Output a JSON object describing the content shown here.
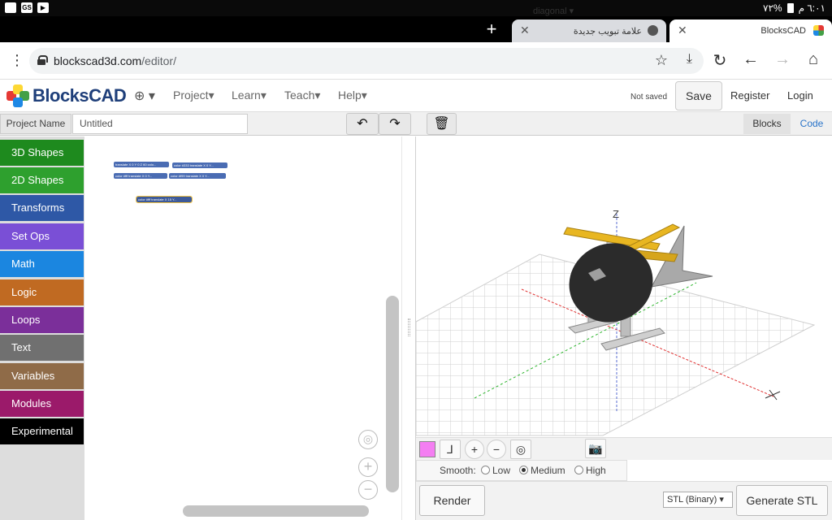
{
  "status_bar": {
    "left_icons": [
      "gallery-icon",
      "gs-icon",
      "youtube-icon"
    ],
    "gs_label": "GS",
    "battery": "٧٢%",
    "time": "٦:٠١ م"
  },
  "tabs": [
    {
      "title": "علامة تبويب جديدة",
      "active": false
    },
    {
      "title": "BlocksCAD",
      "active": true
    }
  ],
  "address": {
    "host": "blockscad3d.com",
    "path": "/editor/"
  },
  "header": {
    "logo_text": "BlocksCAD",
    "menus": [
      "Project",
      "Learn",
      "Teach",
      "Help"
    ],
    "save_status": "Not saved",
    "save_label": "Save",
    "register_label": "Register",
    "login_label": "Login"
  },
  "project": {
    "name_label": "Project Name",
    "name_value": "Untitled",
    "blocks_tab": "Blocks",
    "code_tab": "Code"
  },
  "categories": [
    {
      "label": "3D Shapes",
      "color": "#1e8a1e"
    },
    {
      "label": "2D Shapes",
      "color": "#2ea02e"
    },
    {
      "label": "Transforms",
      "color": "#2e58a6"
    },
    {
      "label": "Set Ops",
      "color": "#7a4fd6"
    },
    {
      "label": "Math",
      "color": "#1b86e0"
    },
    {
      "label": "Logic",
      "color": "#c06a22"
    },
    {
      "label": "Loops",
      "color": "#7b2f9a"
    },
    {
      "label": "Text",
      "color": "#707070"
    },
    {
      "label": "Variables",
      "color": "#8f6b48"
    },
    {
      "label": "Modules",
      "color": "#9b1a6a"
    },
    {
      "label": "Experimental",
      "color": "#000000"
    }
  ],
  "workspace_blocks": [
    "translate X 0 Y 0 Z 60 colo...",
    "color #333 translate X 0 Y...",
    "color #fff translate X 0 Y...",
    "color #f99 translate X 0 Y...",
    "color #fff translate X 15 Y..."
  ],
  "viewer": {
    "axis_label": "Z",
    "view_option": "diagonal",
    "swatch_color": "#f47ef2",
    "smooth_label": "Smooth:",
    "smooth_options": [
      "Low",
      "Medium",
      "High"
    ],
    "smooth_selected": "Medium",
    "render_label": "Render",
    "format_option": "STL (Binary)",
    "generate_label": "Generate STL"
  }
}
